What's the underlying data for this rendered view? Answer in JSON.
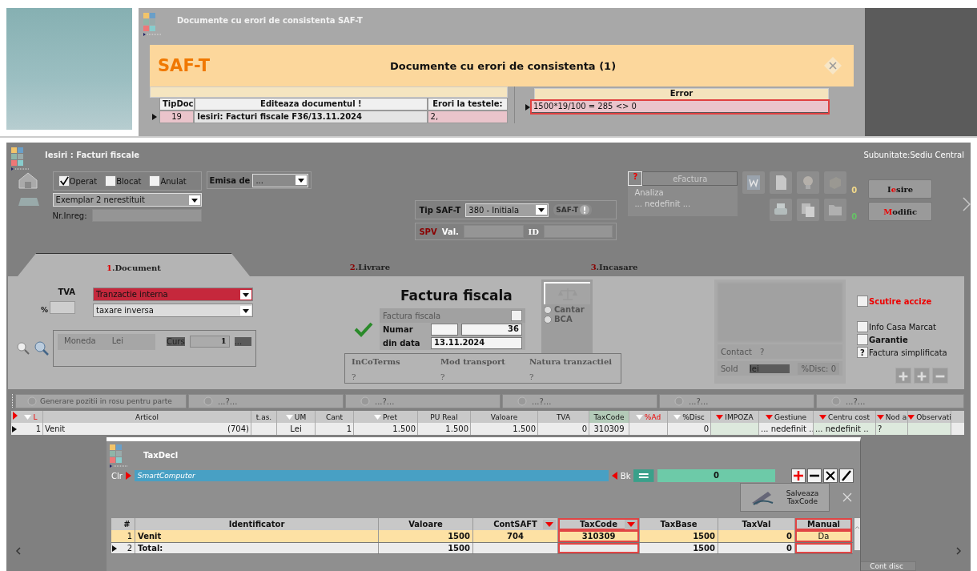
{
  "saft_dialog": {
    "title": "Documente cu erori de consistenta SAF-T",
    "brand": "SAF-T",
    "heading": "Documente cu erori de consistenta (1)",
    "columns": [
      {
        "label": "TipDoc"
      },
      {
        "label": "Editeaza documentul !"
      },
      {
        "label": "Erori la testele:"
      }
    ],
    "rows": [
      {
        "cells": [
          "19",
          "Iesiri: Facturi fiscale F36/13.11.2024",
          "2,"
        ],
        "current": true
      }
    ],
    "error_column": "Error",
    "errors": [
      {
        "text": "1500*19/100 = 285 <> 0",
        "highlighted": true,
        "current": true
      }
    ]
  },
  "invoice_window": {
    "title": "Iesiri : Facturi fiscale",
    "subunit": "Subunitate:Sediu Central",
    "status_checks": [
      {
        "label": "Operat",
        "checked": true
      },
      {
        "label": "Blocat",
        "checked": false
      },
      {
        "label": "Anulat",
        "checked": false
      }
    ],
    "emisa_label": "Emisa de",
    "emisa_value": "...",
    "exemplar": "Exemplar 2 nerestituit",
    "nr_inreg_label": "Nr.Inreg:",
    "tip_saft_label": "Tip SAF-T",
    "tip_saft_value": "380 - Initiala",
    "saft_badge": "SAF-T",
    "spv_label": "SPV",
    "val_label": "Val.",
    "id_label": "ID",
    "efactura_mark": "?",
    "efactura_button": "eFactura",
    "analiza_label": "Analiza",
    "analiza_value": "... nedefinit ...",
    "counters": [
      {
        "text": "0",
        "color": "#f2d98a"
      },
      {
        "text": "0",
        "color": "#66c266"
      }
    ],
    "buttons": [
      {
        "before": "I",
        "key": "e",
        "after": "sire"
      },
      {
        "key": "M",
        "after": "odific"
      }
    ],
    "tabs": [
      {
        "number": "1",
        "label": ".Document",
        "selected": true
      },
      {
        "number": "2",
        "label": ".Livrare",
        "selected": false
      },
      {
        "number": "3",
        "label": ".Incasare",
        "selected": false
      }
    ],
    "document": {
      "tva_label": "TVA",
      "tva_type": "Tranzactie interna",
      "tva_mode": "taxare inversa",
      "percent_label": "%",
      "moneda_label": "Moneda",
      "moneda_value": "Lei",
      "curs_label": "Curs",
      "curs_value": "1",
      "curs_more": "...",
      "title": "Factura fiscala",
      "doc_type": "Factura fiscala",
      "doc_type_checked": false,
      "numar_label": "Numar",
      "numar_value": "36",
      "date_label": "din data",
      "date_value": "13.11.2024",
      "scale_options": [
        {
          "label": "Cantar",
          "selected": false
        },
        {
          "label": "BCA",
          "selected": false
        }
      ],
      "trade_fields": [
        {
          "label": "InCoTerms",
          "value": "?"
        },
        {
          "label": "Mod transport",
          "value": "?"
        },
        {
          "label": "Natura tranzactiei",
          "value": "?"
        }
      ],
      "contact_label": "Contact",
      "contact_value": "?",
      "sold_label": "Sold",
      "sold_value": "lei",
      "disc": "%Disc: 0",
      "flags": [
        {
          "label": "Scutire accize",
          "checked": false,
          "kind": "alert"
        },
        {
          "label": "Info Casa Marcat",
          "checked": false,
          "kind": "plain"
        },
        {
          "label": "Garantie",
          "checked": false,
          "kind": "bold"
        },
        {
          "label": "Factura simplificata",
          "indeterminate": true,
          "kind": "unknown",
          "mark": "?"
        }
      ]
    },
    "action_bar": [
      "Generare pozitii in rosu pentru parte",
      "...?...",
      "...?...",
      "...?...",
      "...?...",
      "...?..."
    ],
    "lines_table": {
      "columns": [
        {
          "label": "L",
          "filter": true,
          "color": "#ffffff",
          "red": true
        },
        {
          "label": "Articol",
          "filter": false,
          "red": false
        },
        {
          "label": "t.as.",
          "filter": false,
          "red": false
        },
        {
          "label": "UM",
          "filter": true,
          "color": "#ffffff",
          "red": false
        },
        {
          "label": "Cant",
          "filter": false,
          "red": false
        },
        {
          "label": "Pret",
          "filter": true,
          "color": "#ffffff",
          "red": false
        },
        {
          "label": "PU Real",
          "filter": false,
          "red": false
        },
        {
          "label": "Valoare",
          "filter": false,
          "red": false
        },
        {
          "label": "TVA",
          "filter": false,
          "red": false
        },
        {
          "label": "TaxCode",
          "filter": false,
          "red": false
        },
        {
          "label": "%Ad",
          "filter": true,
          "color": "#ffffff",
          "red": true
        },
        {
          "label": "%Disc",
          "filter": true,
          "color": "#ffffff",
          "red": false
        },
        {
          "label": "IMPOZA",
          "filter": true,
          "color": "#ee0000",
          "red": false
        },
        {
          "label": "Gestiune",
          "filter": true,
          "color": "#ee0000",
          "red": false
        },
        {
          "label": "Centru cost",
          "filter": true,
          "color": "#ee0000",
          "red": false
        },
        {
          "label": "Nod a",
          "filter": true,
          "color": "#ee0000",
          "red": false
        },
        {
          "label": "Observati",
          "filter": true,
          "color": "#ee0000",
          "red": false
        }
      ],
      "rows": [
        {
          "account": "(704)",
          "cells": [
            "1",
            "Venit",
            "",
            "Lei",
            "1",
            "1.500",
            "1.500",
            "1.500",
            "0",
            "310309",
            "",
            "0",
            "",
            "... nedefinit ..",
            "... nedefinit ..",
            "?",
            ""
          ],
          "current": true
        }
      ]
    },
    "footer_button": "Cont disc"
  },
  "taxdecl_dialog": {
    "title": "TaxDecl",
    "clr_label": "Clr",
    "search_value": "SmartComputer",
    "bk_label": "Bk",
    "counter": "0",
    "save_button": "Salveaza TaxCode",
    "columns": [
      {
        "label": "#",
        "filter": false,
        "highlighted": false
      },
      {
        "label": "Identificator",
        "filter": false,
        "highlighted": false
      },
      {
        "label": "Valoare",
        "filter": false,
        "highlighted": false
      },
      {
        "label": "ContSAFT",
        "filter": true,
        "highlighted": false
      },
      {
        "label": "TaxCode",
        "filter": true,
        "highlighted": true
      },
      {
        "label": "TaxBase",
        "filter": false,
        "highlighted": false
      },
      {
        "label": "TaxVal",
        "filter": false,
        "highlighted": false
      },
      {
        "label": "Manual",
        "filter": false,
        "highlighted": true
      }
    ],
    "rows": [
      {
        "kind": "item",
        "selected": true,
        "current": false,
        "cells": [
          "1",
          "Venit",
          "1500",
          "704",
          "310309",
          "1500",
          "0",
          "Da"
        ]
      },
      {
        "kind": "total",
        "selected": false,
        "current": true,
        "cells": [
          "2",
          "Total:",
          "1500",
          "",
          "",
          "1500",
          "0",
          ""
        ]
      }
    ]
  }
}
